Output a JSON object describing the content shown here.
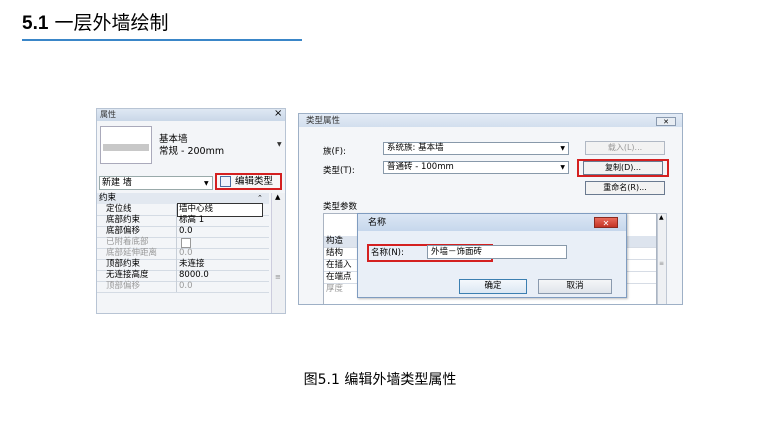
{
  "heading": {
    "number": "5.1",
    "title": "一层外墙绘制"
  },
  "properties_panel": {
    "title": "属性",
    "close": "×",
    "type_name_line1": "基本墙",
    "type_name_line2": "常规 - 200mm",
    "instance_selector": "新建 墙",
    "edit_type_label": "编辑类型",
    "group_header": "约束",
    "rows": [
      {
        "key": "定位线",
        "value": "墙中心线"
      },
      {
        "key": "底部约束",
        "value": "标高 1"
      },
      {
        "key": "底部偏移",
        "value": "0.0"
      },
      {
        "key": "已附着底部",
        "value": ""
      },
      {
        "key": "底部延伸距离",
        "value": "0.0"
      },
      {
        "key": "顶部约束",
        "value": "未连接"
      },
      {
        "key": "无连接高度",
        "value": "8000.0"
      },
      {
        "key": "顶部偏移",
        "value": "0.0"
      }
    ]
  },
  "type_dialog": {
    "title": "类型属性",
    "family_label": "族(F):",
    "family_value": "系统族: 基本墙",
    "type_label": "类型(T):",
    "type_value": "普通砖 - 100mm",
    "load_button": "载入(L)...",
    "duplicate_button": "复制(D)...",
    "rename_button": "重命名(R)...",
    "params_label": "类型参数",
    "grid_rows": [
      "构造",
      "结构",
      "在插入",
      "在端点",
      "厚度"
    ]
  },
  "name_dialog": {
    "title": "名称",
    "name_label": "名称(N):",
    "name_value": "外墙－饰面砖",
    "ok_button": "确定",
    "cancel_button": "取消"
  },
  "caption": "图5.1  编辑外墙类型属性",
  "colors": {
    "accent_rule": "#3a86c8",
    "highlight_red": "#d42020"
  }
}
